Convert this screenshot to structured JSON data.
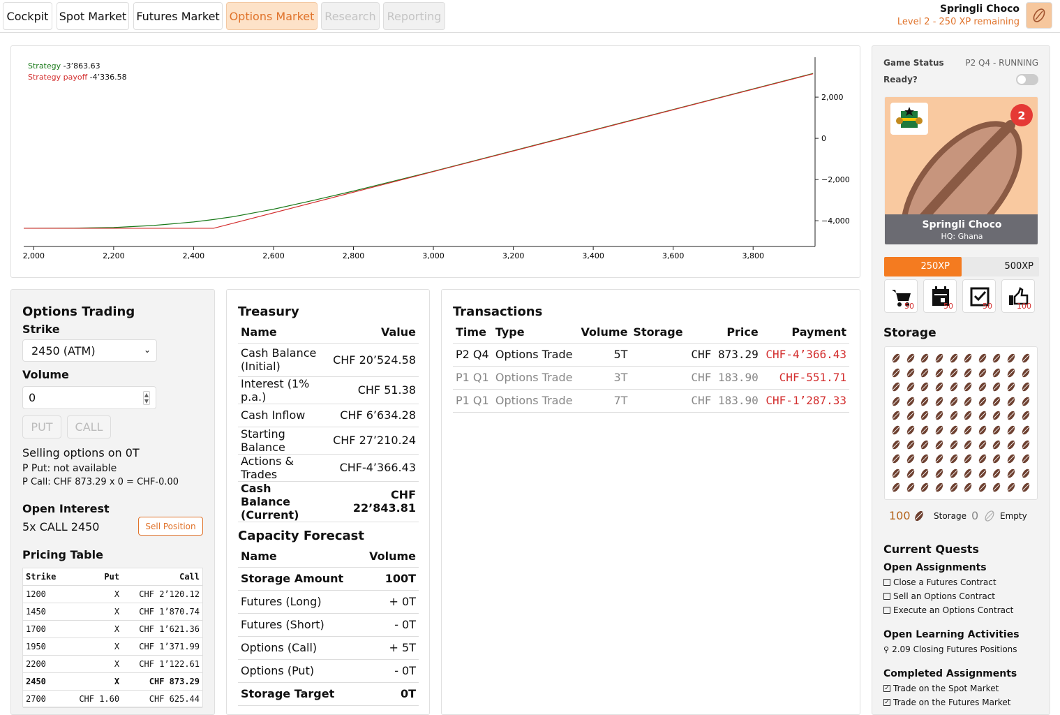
{
  "tabs": [
    {
      "label": "Cockpit",
      "state": "normal"
    },
    {
      "label": "Spot Market",
      "state": "normal"
    },
    {
      "label": "Futures Market",
      "state": "normal"
    },
    {
      "label": "Options Market",
      "state": "active"
    },
    {
      "label": "Research",
      "state": "disabled"
    },
    {
      "label": "Reporting",
      "state": "disabled"
    }
  ],
  "user": {
    "name": "Springli Choco",
    "level": "Level 2 - 250 XP remaining"
  },
  "chart_data": {
    "type": "line",
    "x_ticks": [
      2000,
      2200,
      2400,
      2600,
      2800,
      3000,
      3200,
      3400,
      3600,
      3800
    ],
    "x_tick_labels": [
      "2,000",
      "2,200",
      "2,400",
      "2,600",
      "2,800",
      "3,000",
      "3,200",
      "3,400",
      "3,600",
      "3,800"
    ],
    "y_ticks": [
      2000,
      0,
      -2000,
      -4000
    ],
    "y_tick_labels": [
      "2,000",
      "0",
      "−2,000",
      "−4,000"
    ],
    "xlim": [
      1975,
      3955
    ],
    "ylim": [
      -5250,
      3800
    ],
    "series": [
      {
        "name": "Strategy",
        "value_label": "-3’863.63",
        "color": "#1a7a1a",
        "x": [
          1975,
          2100,
          2200,
          2300,
          2400,
          2450,
          2500,
          2600,
          2700,
          2800,
          2900,
          3000,
          3200,
          3400,
          3600,
          3800,
          3950
        ],
        "y": [
          -4366,
          -4360,
          -4330,
          -4230,
          -4060,
          -3940,
          -3800,
          -3440,
          -3010,
          -2560,
          -2080,
          -1600,
          -600,
          400,
          1400,
          2400,
          3150
        ]
      },
      {
        "name": "Strategy payoff",
        "value_label": "-4’336.58",
        "color": "#d32f2f",
        "x": [
          1975,
          2450,
          3950
        ],
        "y": [
          -4366,
          -4366,
          3134
        ]
      }
    ]
  },
  "trading": {
    "title": "Options Trading",
    "strike_label": "Strike",
    "strike_value": "2450 (ATM)",
    "volume_label": "Volume",
    "volume_value": "0",
    "put": "PUT",
    "call": "CALL",
    "selling": "Selling options on 0T",
    "p_put": "P Put: not available",
    "p_call": "P Call: CHF 873.29 x 0 = CHF-0.00",
    "open_interest_title": "Open Interest",
    "open_interest": "5x CALL 2450",
    "sell_position": "Sell Position",
    "pricing_title": "Pricing Table",
    "pricing_headers": [
      "Strike",
      "Put",
      "Call"
    ],
    "pricing_rows": [
      [
        "1200",
        "X",
        "CHF 2’120.12"
      ],
      [
        "1450",
        "X",
        "CHF 1’870.74"
      ],
      [
        "1700",
        "X",
        "CHF 1’621.36"
      ],
      [
        "1950",
        "X",
        "CHF 1’371.99"
      ],
      [
        "2200",
        "X",
        "CHF 1’122.61"
      ],
      [
        "2450",
        "X",
        "CHF 873.29"
      ],
      [
        "2700",
        "CHF 1.60",
        "CHF 625.44"
      ]
    ]
  },
  "treasury": {
    "title": "Treasury",
    "headers": [
      "Name",
      "Value"
    ],
    "rows": [
      [
        "Cash Balance (Initial)",
        "CHF 20’524.58"
      ],
      [
        "Interest (1% p.a.)",
        "CHF 51.38"
      ],
      [
        "Cash Inflow",
        "CHF 6’634.28"
      ],
      [
        "Starting Balance",
        "CHF 27’210.24"
      ],
      [
        "Actions & Trades",
        "CHF-4’366.43"
      ],
      [
        "Cash Balance (Current)",
        "CHF 22’843.81"
      ]
    ],
    "capacity_title": "Capacity Forecast",
    "capacity_headers": [
      "Name",
      "Volume"
    ],
    "capacity_rows": [
      [
        "Storage Amount",
        "100T"
      ],
      [
        "Futures (Long)",
        "+ 0T"
      ],
      [
        "Futures (Short)",
        "- 0T"
      ],
      [
        "Options (Call)",
        "+ 5T"
      ],
      [
        "Options (Put)",
        "- 0T"
      ],
      [
        "Storage Target",
        "0T"
      ]
    ]
  },
  "transactions": {
    "title": "Transactions",
    "headers": [
      "Time",
      "Type",
      "Volume",
      "Storage",
      "Price",
      "Payment"
    ],
    "rows": [
      [
        "P2 Q4",
        "Options Trade",
        "5T",
        "",
        "CHF 873.29",
        "CHF-4’366.43"
      ],
      [
        "P1 Q1",
        "Options Trade",
        "3T",
        "",
        "CHF 183.90",
        "CHF-551.71"
      ],
      [
        "P1 Q1",
        "Options Trade",
        "7T",
        "",
        "CHF 183.90",
        "CHF-1’287.33"
      ]
    ]
  },
  "side": {
    "game_status_label": "Game Status",
    "game_status": "P2 Q4 - RUNNING",
    "ready_label": "Ready?",
    "company": "Springli Choco",
    "hq": "HQ: Ghana",
    "badge": "2",
    "xp_current": "250XP",
    "xp_next": "500XP",
    "xp_progress": 0.5,
    "actions": [
      {
        "icon": "cart-icon",
        "count": "50"
      },
      {
        "icon": "calendar-icon",
        "count": "50"
      },
      {
        "icon": "checkbox-icon",
        "count": "50"
      },
      {
        "icon": "transport-icon",
        "count": "100"
      }
    ],
    "storage_title": "Storage",
    "storage_count": "100",
    "storage_label": "Storage",
    "empty_count": "0",
    "empty_label": "Empty",
    "quests_title": "Current Quests",
    "open_title": "Open Assignments",
    "open": [
      "Close a Futures Contract",
      "Sell an Options Contract",
      "Execute an Options Contract"
    ],
    "learning_title": "Open Learning Activities",
    "learning": [
      "2.09 Closing Futures Positions"
    ],
    "completed_title": "Completed Assignments",
    "completed": [
      "Trade on the Spot Market",
      "Trade on the Futures Market"
    ]
  }
}
